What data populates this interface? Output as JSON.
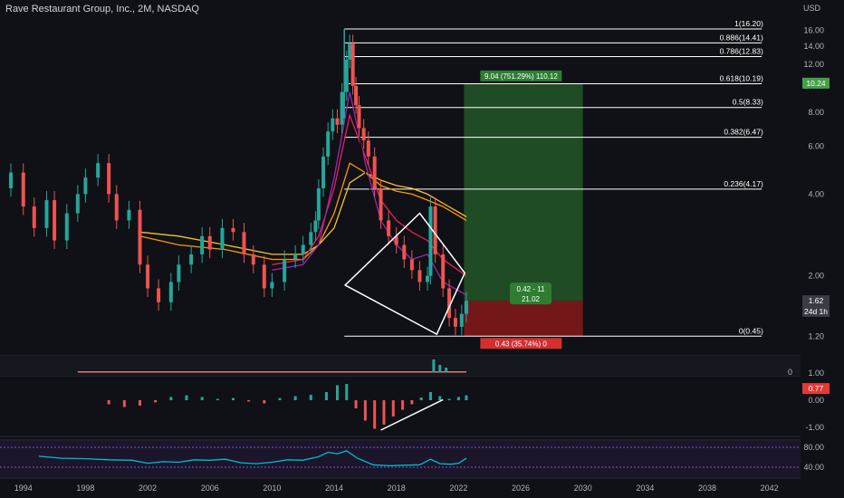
{
  "title": "Rave Restaurant Group, Inc., 2M, NASDAQ",
  "currency": "USD",
  "colors": {
    "background": "#0f1116",
    "up": "#26a69a",
    "down": "#ef5350",
    "fib_line": "#ffffff",
    "profit_zone": "#2e7d32",
    "loss_zone": "#b71c1c",
    "rsi_band": "#7e57c2",
    "rsi_line": "#00bcd4"
  },
  "chart_data": {
    "type": "line",
    "xlim": [
      1992.5,
      2044
    ],
    "x_ticks": [
      "1994",
      "1998",
      "2002",
      "2006",
      "2010",
      "2014",
      "2018",
      "2022",
      "2026",
      "2030",
      "2034",
      "2038",
      "2042"
    ],
    "price_axis": {
      "scale": "log",
      "ticks": [
        "16.00",
        "14.00",
        "12.00",
        "10.00",
        "8.00",
        "6.00",
        "4.00",
        "2.00",
        "1.20"
      ]
    },
    "price_series": {
      "name": "",
      "x": [
        1992.5,
        1993.2,
        1994,
        1994.7,
        1995.5,
        1996,
        1996.8,
        1997.5,
        1998,
        1998.8,
        1999.5,
        2000,
        2000.8,
        2001.5,
        2002,
        2002.7,
        2003.5,
        2004,
        2004.8,
        2005.5,
        2006,
        2006.8,
        2007.5,
        2008.2,
        2008.8,
        2009.5,
        2010,
        2010.8,
        2011.5,
        2012,
        2012.5,
        2012.8,
        2013,
        2013.3,
        2013.6,
        2013.9,
        2014.2,
        2014.5,
        2014.8,
        2015,
        2015.2,
        2015.4,
        2015.6,
        2015.9,
        2016.2,
        2016.6,
        2017,
        2017.5,
        2018,
        2018.5,
        2019,
        2019.5,
        2020,
        2020.2,
        2020.5,
        2021,
        2021.4,
        2021.8,
        2022.2,
        2022.5
      ],
      "values": [
        4.2,
        4.8,
        3.6,
        3.0,
        3.8,
        2.7,
        3.4,
        4.0,
        4.6,
        5.2,
        4.0,
        3.2,
        3.5,
        2.2,
        1.8,
        1.6,
        1.9,
        2.2,
        2.4,
        2.8,
        2.5,
        3.0,
        2.9,
        2.4,
        2.2,
        1.8,
        1.9,
        2.3,
        2.4,
        2.6,
        2.9,
        3.2,
        4.2,
        5.5,
        6.8,
        7.6,
        7.2,
        9.5,
        12.5,
        14.3,
        10.0,
        8.5,
        7.0,
        6.3,
        5.5,
        4.2,
        3.2,
        2.8,
        2.6,
        2.3,
        2.1,
        1.9,
        2.0,
        3.6,
        2.4,
        1.8,
        1.4,
        1.3,
        1.45,
        1.62
      ]
    },
    "fib_levels": [
      {
        "label": "1(16.20)",
        "value": 16.2
      },
      {
        "label": "0.886(14.41)",
        "value": 14.41
      },
      {
        "label": "0.786(12.83)",
        "value": 12.83
      },
      {
        "label": "0.618(10.19)",
        "value": 10.19
      },
      {
        "label": "0.5(8.33)",
        "value": 8.33
      },
      {
        "label": "0.382(6.47)",
        "value": 6.47
      },
      {
        "label": "0.236(4.17)",
        "value": 4.17
      },
      {
        "label": "0(0.45)",
        "value": 1.2
      }
    ],
    "position": {
      "target_label": "9.04 (751.29%) 110.12",
      "stop_label": "0.43 (35.74%) 0",
      "ratio_label_1": "0.42 - 11",
      "ratio_label_2": "21.02",
      "target_price": 10.24,
      "entry_price": 1.62,
      "stop_price": 1.2
    },
    "price_badges": [
      {
        "text": "10.24",
        "value": 10.24,
        "kind": "green"
      },
      {
        "text": "1.62",
        "value": 1.62,
        "kind": "gray"
      },
      {
        "text": "24d 1h",
        "value": 1.48,
        "kind": "gray"
      },
      {
        "text": "0.77",
        "value": 0.77,
        "kind": "red"
      }
    ],
    "volume_ticks": [
      "0"
    ],
    "macd": {
      "ticks": [
        "1.00",
        "0.00",
        "-1.00"
      ],
      "x": [
        1999.5,
        2000.5,
        2001.5,
        2002.5,
        2003.5,
        2004.5,
        2005.5,
        2006.5,
        2007.5,
        2008.5,
        2009.5,
        2010.5,
        2011.5,
        2012.5,
        2013.5,
        2014.2,
        2014.8,
        2015.4,
        2016,
        2016.6,
        2017.2,
        2017.8,
        2018.4,
        2019,
        2019.6,
        2020.2,
        2020.8,
        2021.4,
        2022,
        2022.5
      ],
      "values": [
        -0.15,
        -0.25,
        -0.2,
        -0.08,
        0.12,
        0.18,
        0.12,
        0.05,
        0.08,
        -0.05,
        -0.12,
        0.08,
        0.15,
        0.2,
        0.3,
        0.55,
        0.6,
        -0.3,
        -0.75,
        -1.05,
        -0.9,
        -0.6,
        -0.35,
        -0.15,
        0.1,
        0.3,
        0.15,
        0.05,
        0.12,
        0.18
      ]
    },
    "rsi": {
      "ticks": [
        "80.00",
        "40.00"
      ],
      "x": [
        1995,
        1996.5,
        1998,
        1999.5,
        2001,
        2002,
        2003,
        2004,
        2005,
        2006,
        2007,
        2008,
        2009,
        2010,
        2011,
        2012,
        2013,
        2013.6,
        2014.2,
        2014.8,
        2015.5,
        2016.5,
        2017.5,
        2018.5,
        2019.5,
        2020.2,
        2020.8,
        2021.5,
        2022,
        2022.5
      ],
      "values": [
        62,
        58,
        57,
        55,
        54,
        48,
        51,
        50,
        55,
        54,
        56,
        49,
        47,
        50,
        55,
        54,
        61,
        70,
        67,
        73,
        58,
        45,
        43,
        44,
        45,
        56,
        47,
        46,
        48,
        58
      ]
    }
  }
}
